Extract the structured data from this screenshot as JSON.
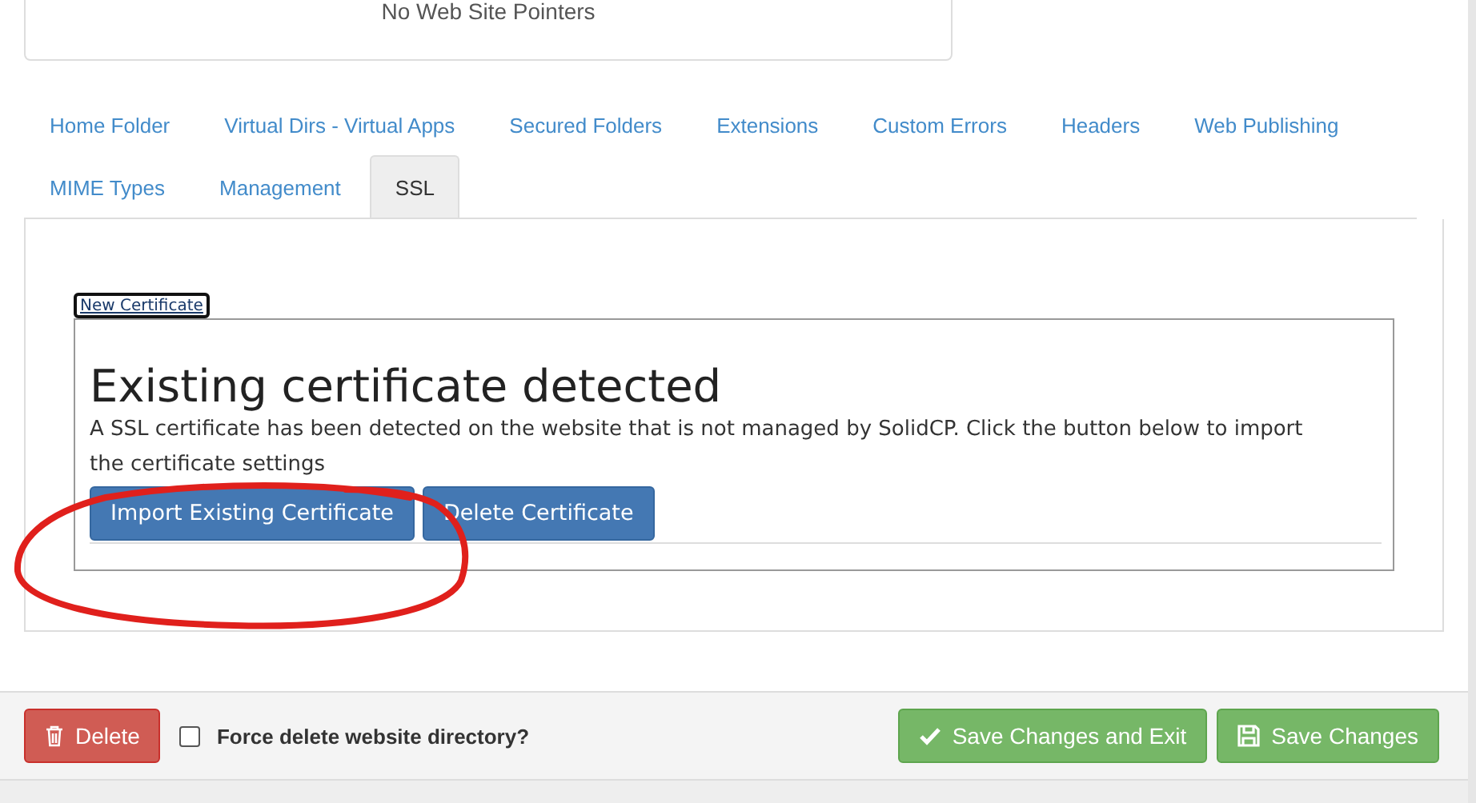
{
  "pointers_panel": {
    "message": "No Web Site Pointers"
  },
  "tabs": [
    {
      "label": "Home Folder",
      "selected": false
    },
    {
      "label": "Virtual Dirs - Virtual Apps",
      "selected": false
    },
    {
      "label": "Secured Folders",
      "selected": false
    },
    {
      "label": "Extensions",
      "selected": false
    },
    {
      "label": "Custom Errors",
      "selected": false
    },
    {
      "label": "Headers",
      "selected": false
    },
    {
      "label": "Web Publishing",
      "selected": false
    },
    {
      "label": "MIME Types",
      "selected": false
    },
    {
      "label": "Management",
      "selected": false
    },
    {
      "label": "SSL",
      "selected": true
    }
  ],
  "ssl_panel": {
    "inner_tabs": [
      {
        "label": "New Certificate",
        "selected": true
      }
    ],
    "heading": "Existing certificate detected",
    "description": "A SSL certificate has been detected on the website that is not managed by SolidCP. Click the button below to import the certificate settings",
    "buttons": [
      "Import Existing Certificate",
      "Delete Certificate"
    ]
  },
  "footer": {
    "delete_button": "Delete",
    "force_delete": {
      "label": "Force delete website directory?",
      "checked": false
    },
    "save_exit_button": "Save Changes and Exit",
    "save_button": "Save Changes"
  }
}
